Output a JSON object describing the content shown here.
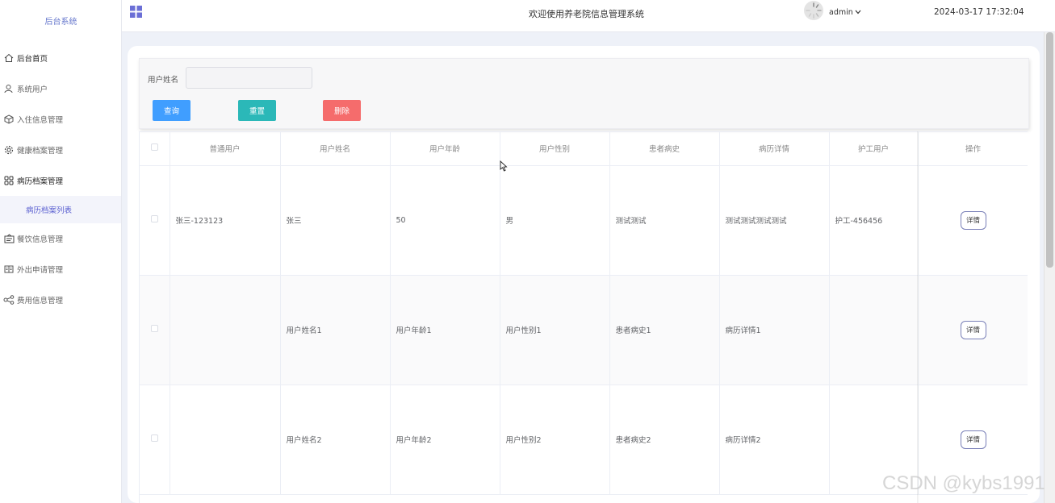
{
  "sidebar": {
    "brand": "后台系统",
    "items": [
      {
        "label": "后台首页",
        "icon": "home-icon"
      },
      {
        "label": "系统用户",
        "icon": "user-icon"
      },
      {
        "label": "入住信息管理",
        "icon": "box-icon"
      },
      {
        "label": "健康档案管理",
        "icon": "gear-icon"
      },
      {
        "label": "病历档案管理",
        "icon": "grid-icon"
      },
      {
        "label": "餐饮信息管理",
        "icon": "menu-board-icon"
      },
      {
        "label": "外出申请管理",
        "icon": "book-icon"
      },
      {
        "label": "费用信息管理",
        "icon": "share-icon"
      }
    ],
    "subitem": {
      "label": "病历档案列表"
    }
  },
  "header": {
    "title": "欢迎使用养老院信息管理系统",
    "username": "admin",
    "datetime": "2024-03-17 17:32:04"
  },
  "search": {
    "label": "用户姓名",
    "value": "",
    "placeholder": "",
    "query_label": "查询",
    "reset_label": "重置",
    "delete_label": "删除"
  },
  "table": {
    "columns": [
      "普通用户",
      "用户姓名",
      "用户年龄",
      "用户性别",
      "患者病史",
      "病历详情",
      "护工用户",
      "操作"
    ],
    "rows": [
      [
        "张三-123123",
        "张三",
        "50",
        "男",
        "测试测试",
        "测试测试测试测试",
        "护工-456456"
      ],
      [
        "",
        "用户姓名1",
        "用户年龄1",
        "用户性别1",
        "患者病史1",
        "病历详情1",
        ""
      ],
      [
        "",
        "用户姓名2",
        "用户年龄2",
        "用户性别2",
        "患者病史2",
        "病历详情2",
        ""
      ]
    ],
    "detail_label": "详情"
  },
  "watermark": "CSDN @kybs1991",
  "colors": {
    "accent": "#5a5fd0",
    "query": "#409eff",
    "reset": "#2bb8b8",
    "delete": "#f56c6c"
  }
}
